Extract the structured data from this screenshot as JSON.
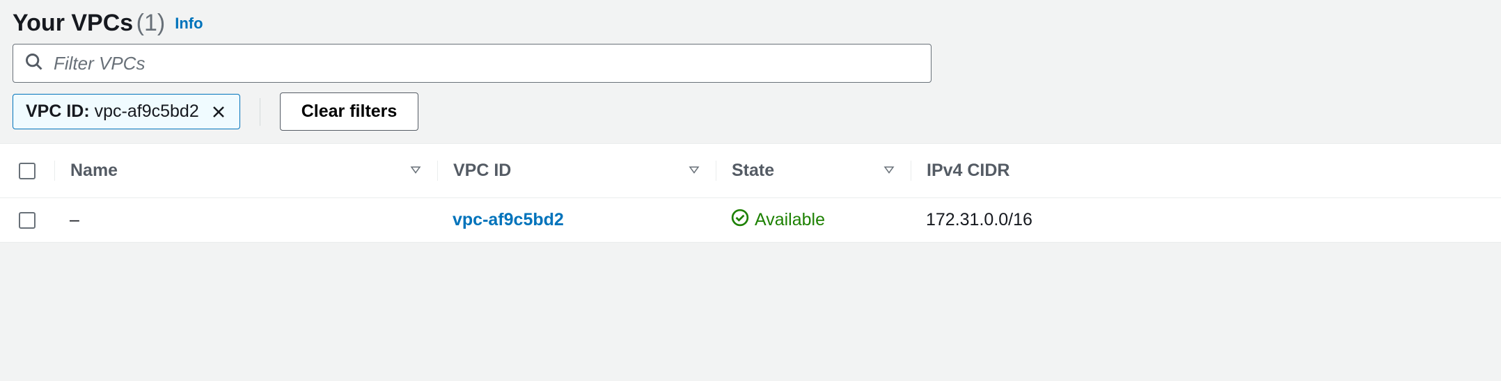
{
  "header": {
    "title": "Your VPCs",
    "count": "(1)",
    "info_label": "Info"
  },
  "search": {
    "placeholder": "Filter VPCs"
  },
  "filters": {
    "active": {
      "key": "VPC ID:",
      "value": "vpc-af9c5bd2"
    },
    "clear_label": "Clear filters"
  },
  "table": {
    "columns": {
      "name": "Name",
      "vpc_id": "VPC ID",
      "state": "State",
      "ipv4_cidr": "IPv4 CIDR"
    },
    "rows": [
      {
        "name": "–",
        "vpc_id": "vpc-af9c5bd2",
        "state": "Available",
        "ipv4_cidr": "172.31.0.0/16"
      }
    ]
  }
}
